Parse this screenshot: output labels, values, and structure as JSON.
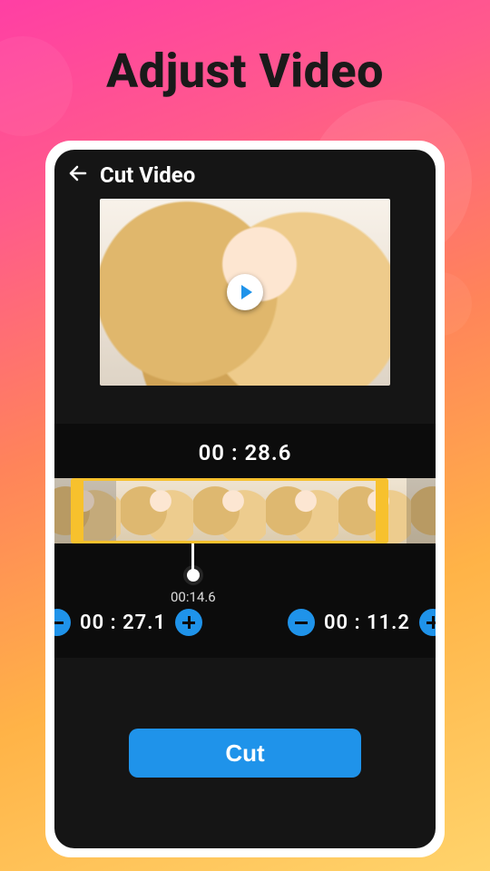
{
  "promo_title": "Adjust Video",
  "app_bar": {
    "title": "Cut Video"
  },
  "trim": {
    "total_time": "00 : 28.6",
    "playhead_time": "00:14.6",
    "start_time": "00 : 27.1",
    "end_time": "00 : 11.2"
  },
  "actions": {
    "cut_label": "Cut"
  },
  "colors": {
    "accent_blue": "#1f93ea",
    "selection_yellow": "#f7c12d"
  }
}
